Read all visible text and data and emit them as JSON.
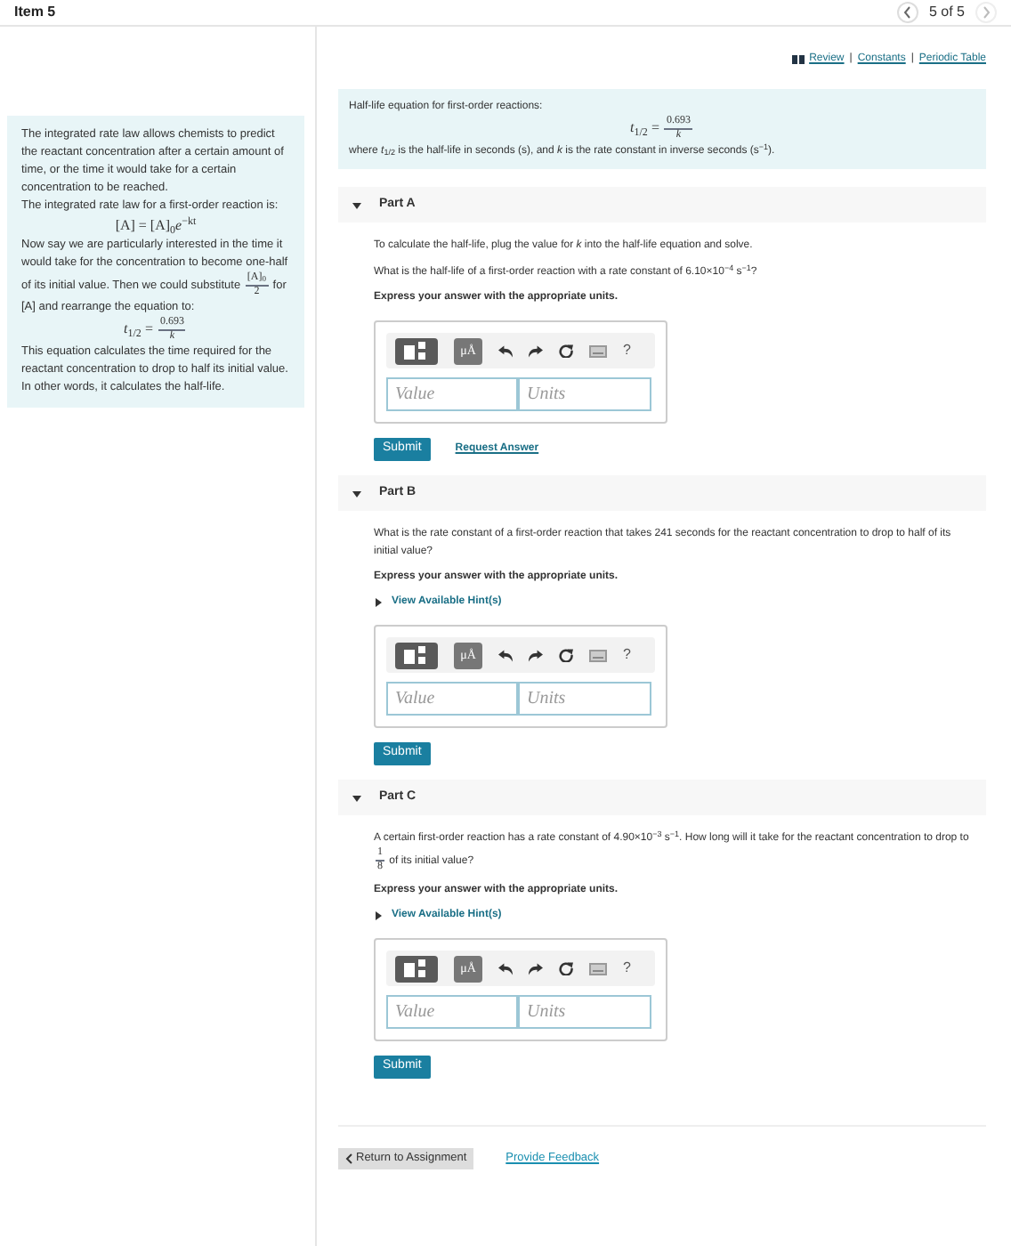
{
  "header": {
    "title": "Item 5",
    "page": "5 of 5"
  },
  "resources": {
    "separator": "|",
    "links": [
      {
        "label": "Review"
      },
      {
        "label": "Constants"
      },
      {
        "label": "Periodic Table"
      }
    ]
  },
  "intro": [
    {
      "kind": "text",
      "segments": [
        {
          "kind": "text",
          "text": "The integrated rate law allows chemists to predict the reactant concentration after a certain amount of time, or the time it would take for a certain concentration to be reached."
        }
      ]
    },
    {
      "kind": "text",
      "segments": [
        {
          "kind": "text",
          "text": "The integrated rate law for a first-order reaction is:"
        }
      ]
    },
    {
      "kind": "equation",
      "segments": [
        {
          "kind": "text",
          "text": "[A] = [A]$_{0}$*e*$^{−kt}$"
        }
      ]
    },
    {
      "kind": "text",
      "segments": [
        {
          "kind": "text",
          "text": "Now say we are particularly interested in the time it would take for the concentration to become one-half of its initial value. Then we could substitute "
        },
        {
          "kind": "fraction",
          "numerator": "[A]$_{0}$",
          "denominator": "2"
        },
        {
          "kind": "text",
          "text": " for [A] and rearrange the equation to:"
        }
      ]
    },
    {
      "kind": "equation",
      "segments": [
        {
          "kind": "text",
          "text": "*t*$_{1/2}$ = "
        },
        {
          "kind": "fraction",
          "numerator": "0.693",
          "denominator": "*k*"
        }
      ]
    },
    {
      "kind": "text",
      "segments": [
        {
          "kind": "text",
          "text": "This equation calculates the time required for the reactant concentration to drop to half its initial value. In other words, it calculates the half-life."
        }
      ]
    }
  ],
  "info": [
    {
      "kind": "text",
      "segments": [
        {
          "kind": "text",
          "text": "Half-life equation for first-order reactions:"
        }
      ]
    },
    {
      "kind": "equation",
      "segments": [
        {
          "kind": "text",
          "text": "*t*$_{1/2}$ = "
        },
        {
          "kind": "fraction",
          "numerator": "0.693",
          "denominator": "*k*"
        }
      ]
    },
    {
      "kind": "text",
      "segments": [
        {
          "kind": "text",
          "text": "where *t*$_{1/2}$ is the half-life in seconds (s), and *k* is the rate constant in inverse seconds (s$^{−1}$)."
        }
      ]
    }
  ],
  "parts": [
    {
      "title": "Part A",
      "expanded": true,
      "paragraphs": [
        {
          "kind": "text",
          "segments": [
            {
              "kind": "text",
              "text": "To calculate the half-life, plug the value for *k* into the half-life equation and solve."
            }
          ]
        },
        {
          "kind": "text",
          "segments": [
            {
              "kind": "text",
              "text": "What is the half-life of a first-order reaction with a rate constant of 6.10×10$^{−4}$ s$^{−1}$?"
            }
          ]
        }
      ],
      "instruction": "Express your answer with the appropriate units.",
      "toolbar": {
        "units_label": "μÅ",
        "help": "?"
      },
      "value_placeholder": "Value",
      "units_placeholder": "Units",
      "submit": "Submit",
      "request_answer": "Request Answer"
    },
    {
      "title": "Part B",
      "expanded": true,
      "paragraphs": [
        {
          "kind": "text",
          "segments": [
            {
              "kind": "text",
              "text": "What is the rate constant of a first-order reaction that takes 241 seconds for the reactant concentration to drop to half of its initial value?"
            }
          ]
        }
      ],
      "instruction": "Express your answer with the appropriate units.",
      "hint": {
        "label": "View Available Hint(s)",
        "expanded": false
      },
      "toolbar": {
        "units_label": "μÅ",
        "help": "?"
      },
      "value_placeholder": "Value",
      "units_placeholder": "Units",
      "submit": "Submit"
    },
    {
      "title": "Part C",
      "expanded": true,
      "paragraphs": [
        {
          "kind": "text",
          "segments": [
            {
              "kind": "text",
              "text": "A certain first-order reaction has a rate constant of 4.90×10$^{−3}$ s$^{−1}$. How long will it take for the reactant concentration to drop to "
            },
            {
              "kind": "fraction",
              "numerator": "1",
              "denominator": "8"
            },
            {
              "kind": "text",
              "text": " of its initial value?"
            }
          ]
        }
      ],
      "instruction": "Express your answer with the appropriate units.",
      "hint": {
        "label": "View Available Hint(s)",
        "expanded": false
      },
      "toolbar": {
        "units_label": "μÅ",
        "help": "?"
      },
      "value_placeholder": "Value",
      "units_placeholder": "Units",
      "submit": "Submit"
    }
  ],
  "footer": {
    "return": "Return to Assignment",
    "feedback": "Provide Feedback"
  }
}
